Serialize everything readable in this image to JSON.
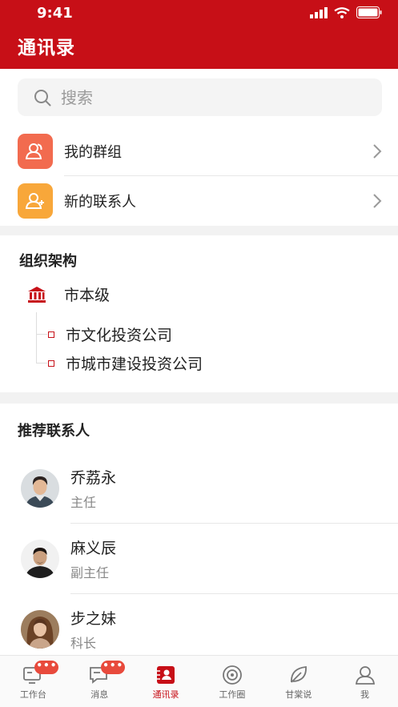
{
  "status": {
    "time": "9:41"
  },
  "header": {
    "title": "通讯录"
  },
  "search": {
    "placeholder": "搜索"
  },
  "quick": [
    {
      "label": "我的群组",
      "icon": "group-icon",
      "color": "#f26b4f"
    },
    {
      "label": "新的联系人",
      "icon": "add-contact-icon",
      "color": "#f8a73a"
    }
  ],
  "org": {
    "title": "组织架构",
    "root": "市本级",
    "children": [
      "市文化投资公司",
      "市城市建设投资公司"
    ]
  },
  "recommended": {
    "title": "推荐联系人",
    "contacts": [
      {
        "name": "乔荔永",
        "role": "主任"
      },
      {
        "name": "麻义辰",
        "role": "副主任"
      },
      {
        "name": "步之妹",
        "role": "科长"
      }
    ]
  },
  "tabs": [
    {
      "label": "工作台",
      "icon": "workbench-icon",
      "badge": "•••"
    },
    {
      "label": "消息",
      "icon": "message-icon",
      "badge": "•••"
    },
    {
      "label": "通讯录",
      "icon": "contacts-icon",
      "active": true
    },
    {
      "label": "工作圈",
      "icon": "work-circle-icon"
    },
    {
      "label": "甘棠说",
      "icon": "leaf-icon"
    },
    {
      "label": "我",
      "icon": "profile-icon"
    }
  ],
  "colors": {
    "brand": "#c70f17",
    "badge": "#e84a3c"
  }
}
